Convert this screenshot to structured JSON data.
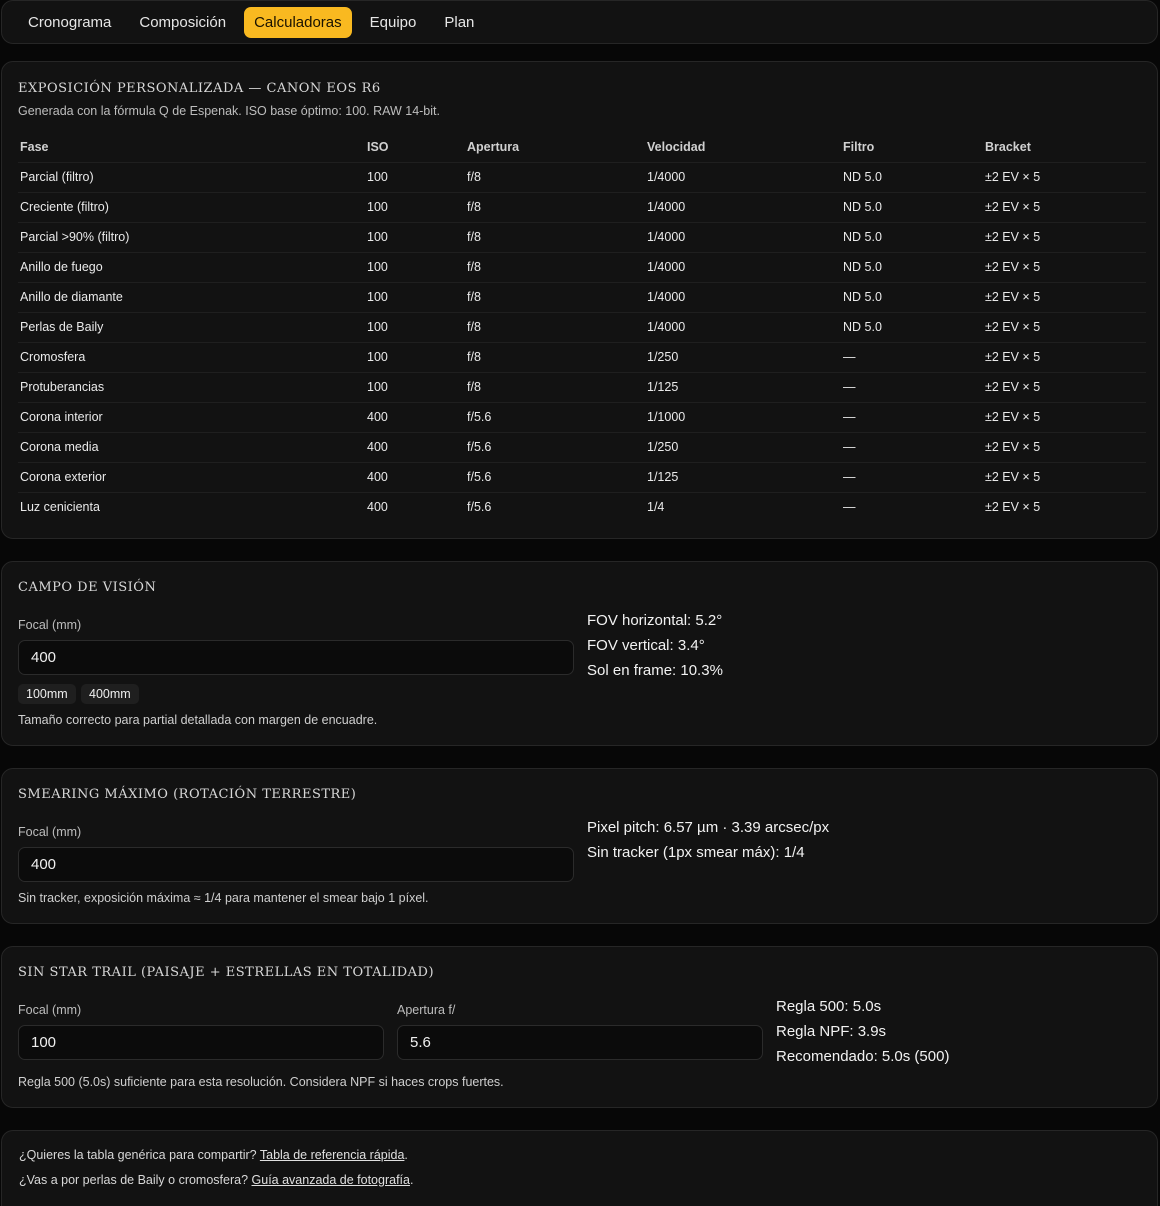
{
  "tabs": [
    "Cronograma",
    "Composición",
    "Calculadoras",
    "Equipo",
    "Plan"
  ],
  "active_tab": 2,
  "exposure": {
    "title": "Exposición personalizada — Canon EOS R6",
    "subtitle": "Generada con la fórmula Q de Espenak. ISO base óptimo: 100. RAW 14-bit.",
    "headers": [
      "Fase",
      "ISO",
      "Apertura",
      "Velocidad",
      "Filtro",
      "Bracket"
    ],
    "rows": [
      [
        "Parcial (filtro)",
        "100",
        "f/8",
        "1/4000",
        "ND 5.0",
        "±2 EV × 5"
      ],
      [
        "Creciente (filtro)",
        "100",
        "f/8",
        "1/4000",
        "ND 5.0",
        "±2 EV × 5"
      ],
      [
        "Parcial >90% (filtro)",
        "100",
        "f/8",
        "1/4000",
        "ND 5.0",
        "±2 EV × 5"
      ],
      [
        "Anillo de fuego",
        "100",
        "f/8",
        "1/4000",
        "ND 5.0",
        "±2 EV × 5"
      ],
      [
        "Anillo de diamante",
        "100",
        "f/8",
        "1/4000",
        "ND 5.0",
        "±2 EV × 5"
      ],
      [
        "Perlas de Baily",
        "100",
        "f/8",
        "1/4000",
        "ND 5.0",
        "±2 EV × 5"
      ],
      [
        "Cromosfera",
        "100",
        "f/8",
        "1/250",
        "—",
        "±2 EV × 5"
      ],
      [
        "Protuberancias",
        "100",
        "f/8",
        "1/125",
        "—",
        "±2 EV × 5"
      ],
      [
        "Corona interior",
        "400",
        "f/5.6",
        "1/1000",
        "—",
        "±2 EV × 5"
      ],
      [
        "Corona media",
        "400",
        "f/5.6",
        "1/250",
        "—",
        "±2 EV × 5"
      ],
      [
        "Corona exterior",
        "400",
        "f/5.6",
        "1/125",
        "—",
        "±2 EV × 5"
      ],
      [
        "Luz cenicienta",
        "400",
        "f/5.6",
        "1/4",
        "—",
        "±2 EV × 5"
      ]
    ]
  },
  "fov": {
    "title": "Campo de visión",
    "focal_label": "Focal (mm)",
    "focal_value": "400",
    "chip_100": "100mm",
    "chip_400": "400mm",
    "note": "Tamaño correcto para partial detallada con margen de encuadre.",
    "result_h": "FOV horizontal: 5.2°",
    "result_v": "FOV vertical: 3.4°",
    "result_sun": "Sol en frame: 10.3%"
  },
  "smear": {
    "title": "Smearing máximo (rotación terrestre)",
    "focal_label": "Focal (mm)",
    "focal_value": "400",
    "note": "Sin tracker, exposición máxima ≈ 1/4 para mantener el smear bajo 1 píxel.",
    "result_pitch": "Pixel pitch: 6.57 µm · 3.39 arcsec/px",
    "result_tracker": "Sin tracker (1px smear máx): 1/4"
  },
  "startrail": {
    "title": "Sin star trail (paisaje + estrellas en totalidad)",
    "focal_label": "Focal (mm)",
    "focal_value": "100",
    "aperture_label": "Apertura f/",
    "aperture_value": "5.6",
    "note": "Regla 500 (5.0s) suficiente para esta resolución. Considera NPF si haces crops fuertes.",
    "result_500": "Regla 500: 5.0s",
    "result_npf": "Regla NPF: 3.9s",
    "result_rec": "Recomendado: 5.0s (500)"
  },
  "footer": {
    "line1_text": "¿Quieres la tabla genérica para compartir? ",
    "line1_link": "Tabla de referencia rápida",
    "line2_text": "¿Vas a por perlas de Baily o cromosfera? ",
    "line2_link": "Guía avanzada de fotografía",
    "dot": "."
  }
}
